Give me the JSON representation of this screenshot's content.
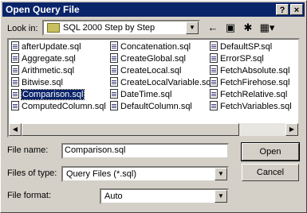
{
  "window": {
    "title": "Open Query File",
    "help_glyph": "?",
    "close_glyph": "×"
  },
  "look_in": {
    "label": "Look in:",
    "value": "SQL 2000 Step by Step"
  },
  "toolbar": {
    "back_glyph": "←",
    "up_glyph": "▣",
    "new_folder_glyph": "✱",
    "view_glyph": "▦▾"
  },
  "files": [
    [
      "afterUpdate.sql",
      "Concatenation.sql",
      "DefaultSP.sql"
    ],
    [
      "Aggregate.sql",
      "CreateGlobal.sql",
      "ErrorSP.sql"
    ],
    [
      "Arithmetic.sql",
      "CreateLocal.sql",
      "FetchAbsolute.sql"
    ],
    [
      "Bitwise.sql",
      "CreateLocalVariable.sql",
      "FetchFirehose.sql"
    ],
    [
      "Comparison.sql",
      "DateTime.sql",
      "FetchRelative.sql"
    ],
    [
      "ComputedColumn.sql",
      "DefaultColumn.sql",
      "FetchVariables.sql"
    ]
  ],
  "selected_file": "Comparison.sql",
  "file_name": {
    "label": "File name:",
    "value": "Comparison.sql"
  },
  "file_type": {
    "label": "Files of type:",
    "value": "Query Files (*.sql)"
  },
  "file_format": {
    "label": "File format:",
    "value": "Auto"
  },
  "buttons": {
    "open": "Open",
    "cancel": "Cancel"
  }
}
